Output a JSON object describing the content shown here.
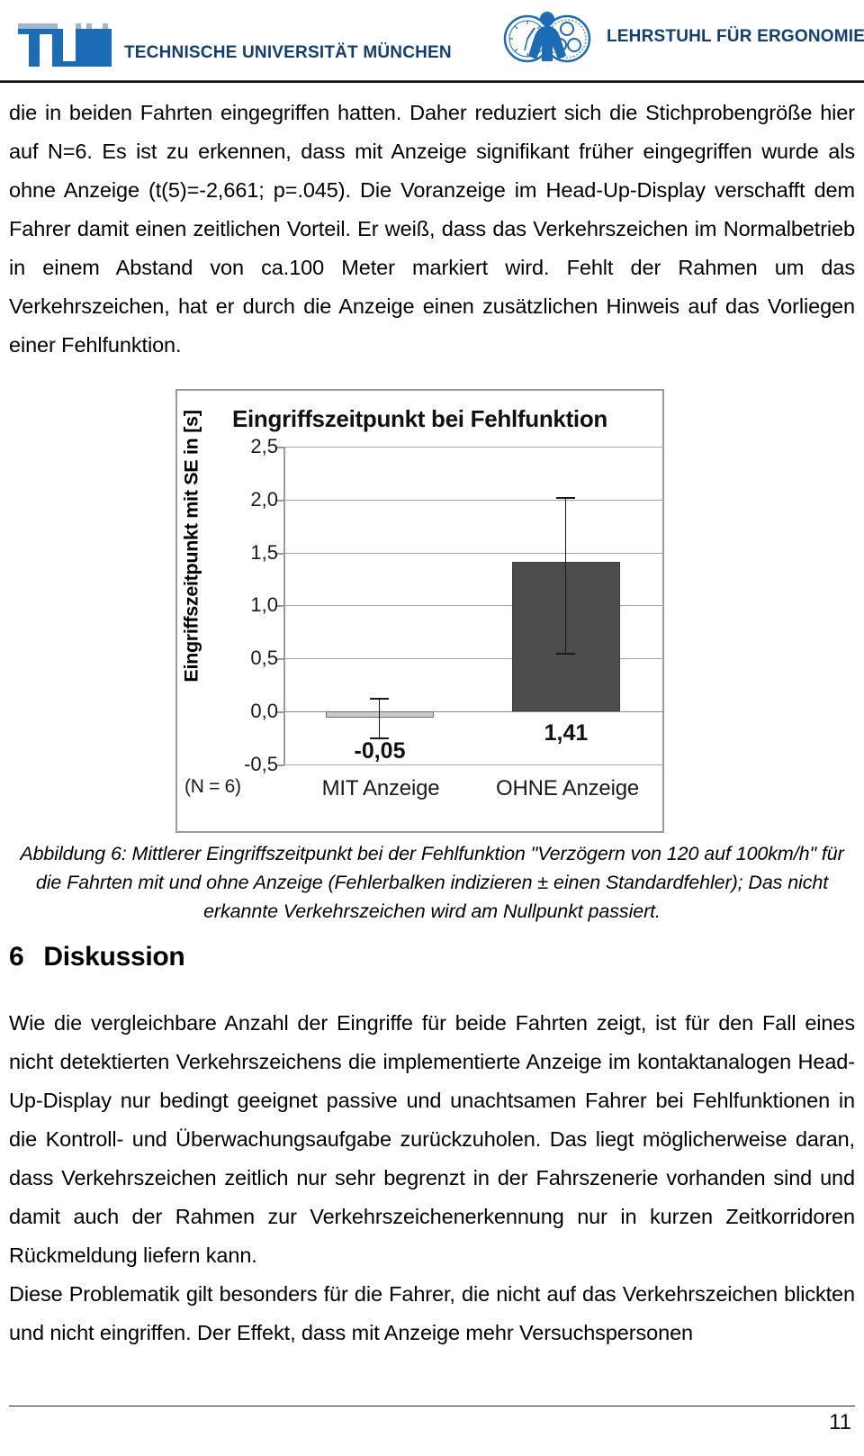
{
  "header": {
    "tum_logo_alt": "TUM",
    "tum_wordmark_parts": [
      "T",
      "ECHNISCHE ",
      "U",
      "NIVERSITÄT ",
      "M",
      "ÜNCHEN"
    ],
    "tum_wordmark": "TECHNISCHE UNIVERSITÄT MÜNCHEN",
    "ergonomics_wordmark": "LEHRSTUHL FÜR ERGONOMIE",
    "brand_color": "#12406e",
    "logo_blue": "#1b6cb5"
  },
  "body": {
    "paragraph_1": "die in beiden Fahrten eingegriffen hatten. Daher reduziert sich die Stichprobengröße hier auf N=6. Es ist zu erkennen, dass mit Anzeige signifikant früher eingegriffen wurde als ohne Anzeige (t(5)=-2,661; p=.045). Die Voranzeige im Head-Up-Display verschafft dem Fahrer damit einen zeitlichen Vorteil. Er weiß, dass das Verkehrszeichen im Normalbetrieb in einem Abstand von ca.100 Meter markiert wird. Fehlt der Rahmen um das Verkehrszeichen, hat er durch die Anzeige einen zusätzlichen Hinweis auf das Vorliegen einer Fehlfunktion."
  },
  "figure": {
    "caption": "Abbildung 6: Mittlerer Eingriffszeitpunkt bei der Fehlfunktion \"Verzögern von 120 auf 100km/h\" für die Fahrten mit und ohne Anzeige (Fehlerbalken indizieren ± einen Standardfehler); Das nicht erkannte Verkehrszeichen wird am Nullpunkt passiert.",
    "sample_note": "(N = 6)"
  },
  "chart_data": {
    "type": "bar",
    "title": "Eingriffszeitpunkt bei Fehlfunktion",
    "categories": [
      "MIT Anzeige",
      "OHNE Anzeige"
    ],
    "values": [
      -0.05,
      1.41
    ],
    "value_labels": [
      "-0,05",
      "1,41"
    ],
    "errors": [
      0.18,
      0.61
    ],
    "error_tops": [
      0.13,
      2.02
    ],
    "error_bottoms": [
      -0.23,
      0.8
    ],
    "xlabel": "",
    "ylabel": "Eingriffszeitpunkt mit SE in [s]",
    "ylim": [
      -0.5,
      2.5
    ],
    "yticks": [
      2.5,
      2.0,
      1.5,
      1.0,
      0.5,
      0.0,
      -0.5
    ],
    "ytick_labels": [
      "2,5",
      "2,0",
      "1,5",
      "1,0",
      "0,5",
      "0,0",
      "-0,5"
    ],
    "grid": true,
    "legend": false,
    "bar_colors": [
      "#c9c9c9",
      "#4d4d4d"
    ],
    "error_bar_note": "± 1 Standardfehler"
  },
  "section": {
    "number": "6",
    "title": "Diskussion",
    "paragraph_1": "Wie die vergleichbare Anzahl der Eingriffe für beide Fahrten zeigt, ist für den Fall eines nicht detektierten Verkehrszeichens die implementierte Anzeige im kontaktanalogen Head-Up-Display nur bedingt geeignet passive und unachtsamen Fahrer bei Fehlfunktionen in die Kontroll- und Überwachungsaufgabe zurückzuholen. Das liegt möglicherweise daran, dass Verkehrszeichen zeitlich nur sehr begrenzt in der Fahrszenerie vorhanden sind und damit auch der Rahmen zur Verkehrszeichenerkennung nur in kurzen Zeitkorridoren Rückmeldung liefern kann.",
    "paragraph_2": "Diese Problematik gilt besonders für die Fahrer, die nicht auf das Verkehrszeichen blickten und nicht eingriffen. Der Effekt, dass mit Anzeige mehr Versuchspersonen"
  },
  "footer": {
    "page_number": "11"
  }
}
